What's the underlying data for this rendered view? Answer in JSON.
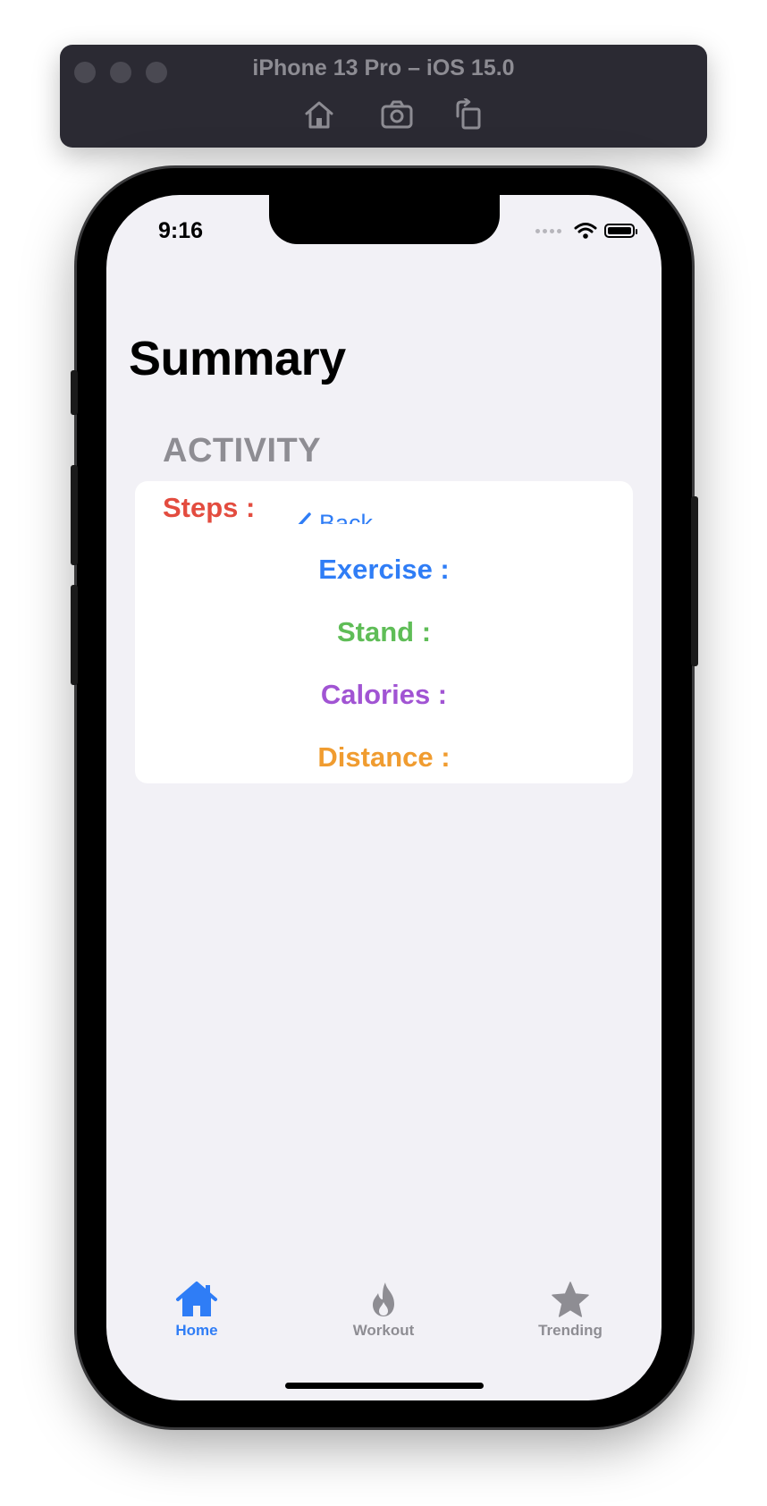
{
  "simulator": {
    "title": "iPhone 13 Pro – iOS 15.0",
    "icons": [
      "home-icon",
      "screenshot-icon",
      "rotate-icon"
    ]
  },
  "status_bar": {
    "time": "9:16",
    "icons": [
      "signal-icon",
      "wifi-icon",
      "battery-icon"
    ]
  },
  "navigation": {
    "large_title": "Summary",
    "back_label": "Back"
  },
  "activity": {
    "section_header": "ACTIVITY",
    "rows": [
      {
        "label": "Steps :",
        "color": "#e34c3f"
      },
      {
        "label": "Exercise :",
        "color": "#2f7df6"
      },
      {
        "label": "Stand :",
        "color": "#5fbd57"
      },
      {
        "label": "Calories :",
        "color": "#a154d3"
      },
      {
        "label": "Distance :",
        "color": "#f09c30"
      }
    ]
  },
  "tab_bar": {
    "active_color": "#2f7df6",
    "inactive_color": "#8e8d93",
    "tabs": [
      {
        "label": "Home",
        "icon": "house-icon",
        "selected": true
      },
      {
        "label": "Workout",
        "icon": "flame-icon",
        "selected": false
      },
      {
        "label": "Trending",
        "icon": "star-icon",
        "selected": false
      }
    ]
  },
  "colors": {
    "background": "#f2f1f6",
    "card": "#ffffff",
    "accent": "#2f7df6"
  }
}
